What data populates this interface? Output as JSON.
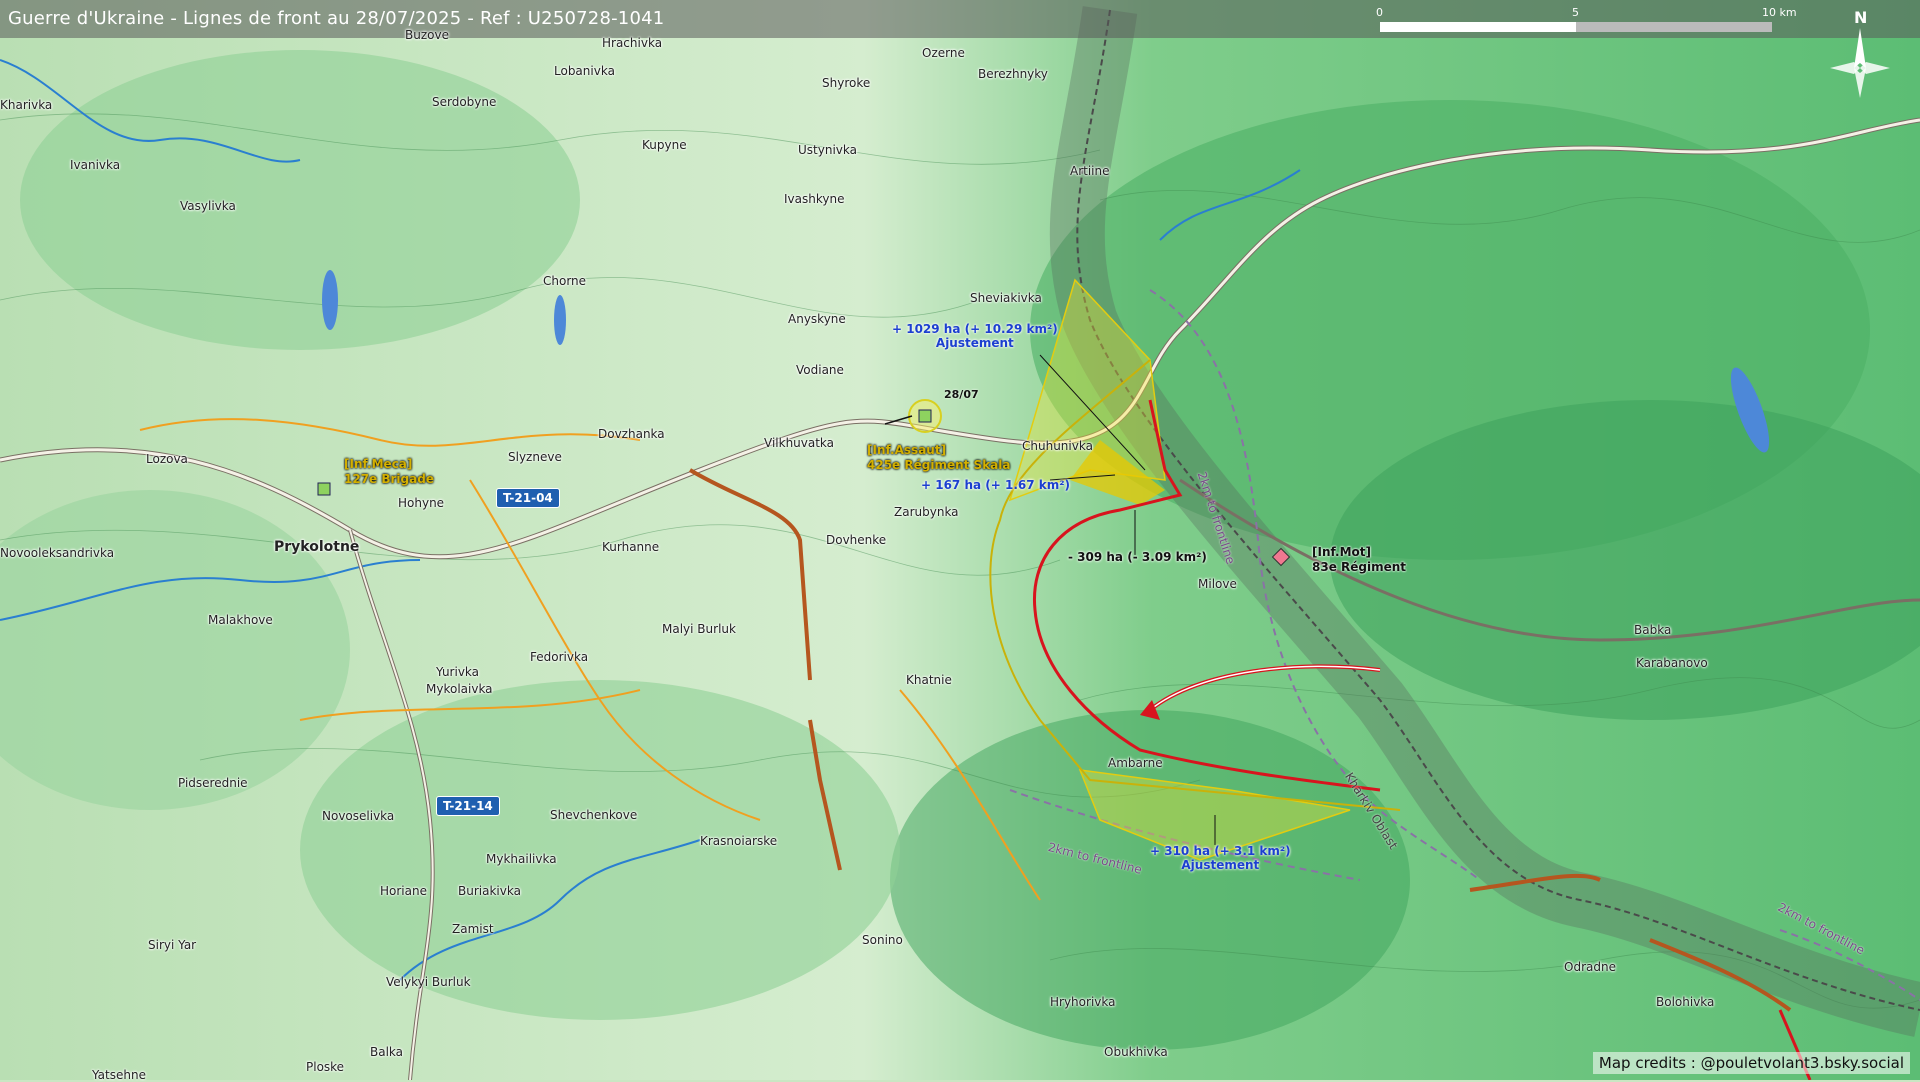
{
  "title": "Guerre d'Ukraine - Lignes de front au 28/07/2025 - Ref : U250728-1041",
  "credits": "Map credits : @pouletvolant3.bsky.social",
  "scale": {
    "zero": "0",
    "mid": "5",
    "max": "10 km"
  },
  "north": "N",
  "places": [
    "Buzove",
    "Hrachivka",
    "Ozerne",
    "Berezhnyky",
    "Lobanivka",
    "Shyroke",
    "Serdobyne",
    "Kharivka",
    "Ivanivka",
    "Kupyne",
    "Ustynivka",
    "Vasylivka",
    "Ivashkyne",
    "Artiine",
    "Chorne",
    "Sheviakivka",
    "Anyskyne",
    "Vodiane",
    "Dovzhanka",
    "Lozova",
    "Slyzneve",
    "Vilkhuvatka",
    "Chuhunivka",
    "Hohyne",
    "Prykolotne",
    "Zarubynka",
    "Dovhenke",
    "Kurhanne",
    "Novooleksandrivka",
    "Malakhove",
    "Malyi Burluk",
    "Fedorivka",
    "Yurivka",
    "Mykolaivka",
    "Khatnie",
    "Milove",
    "Babka",
    "Karabanovo",
    "Pidserednie",
    "Novoselivka",
    "Shevchenkove",
    "Krasnoiarske",
    "Ambarne",
    "Horiane",
    "Buriakivka",
    "Mykhailivka",
    "Zamist",
    "Siryi Yar",
    "Sonino",
    "Velykyi Burluk",
    "Odradne",
    "Bolohivka",
    "Balka",
    "Hryhorivka",
    "Obukhivka",
    "Ploske",
    "Yatsehne"
  ],
  "roads": [
    "T-21-04",
    "T-21-14"
  ],
  "units": {
    "meca": {
      "type": "[Inf.Meca]",
      "name": "127e Brigade"
    },
    "assault": {
      "type": "[Inf.Assaut]",
      "name": "425e Régiment Skala",
      "date": "28/07"
    },
    "mot": {
      "type": "[Inf.Mot]",
      "name": "83e Régiment"
    }
  },
  "annotations": {
    "a1_line1": "+ 1029 ha (+ 10.29 km²)",
    "a1_line2": "Ajustement",
    "a2": "+ 167 ha (+ 1.67 km²)",
    "a3": "- 309 ha (- 3.09 km²)",
    "a4_line1": "+ 310 ha (+ 3.1 km²)",
    "a4_line2": "Ajustement"
  },
  "frontline_labels": [
    "2km to frontline",
    "2km to frontline",
    "2km to frontline"
  ],
  "border_label": "Kharkiv Oblast",
  "colors": {
    "front_red": "#d8141e",
    "gain_yellow": "#f0e020",
    "road_orange": "#f0a020",
    "shield_blue": "#1f5fb0",
    "unit_gold": "#d4b000"
  }
}
